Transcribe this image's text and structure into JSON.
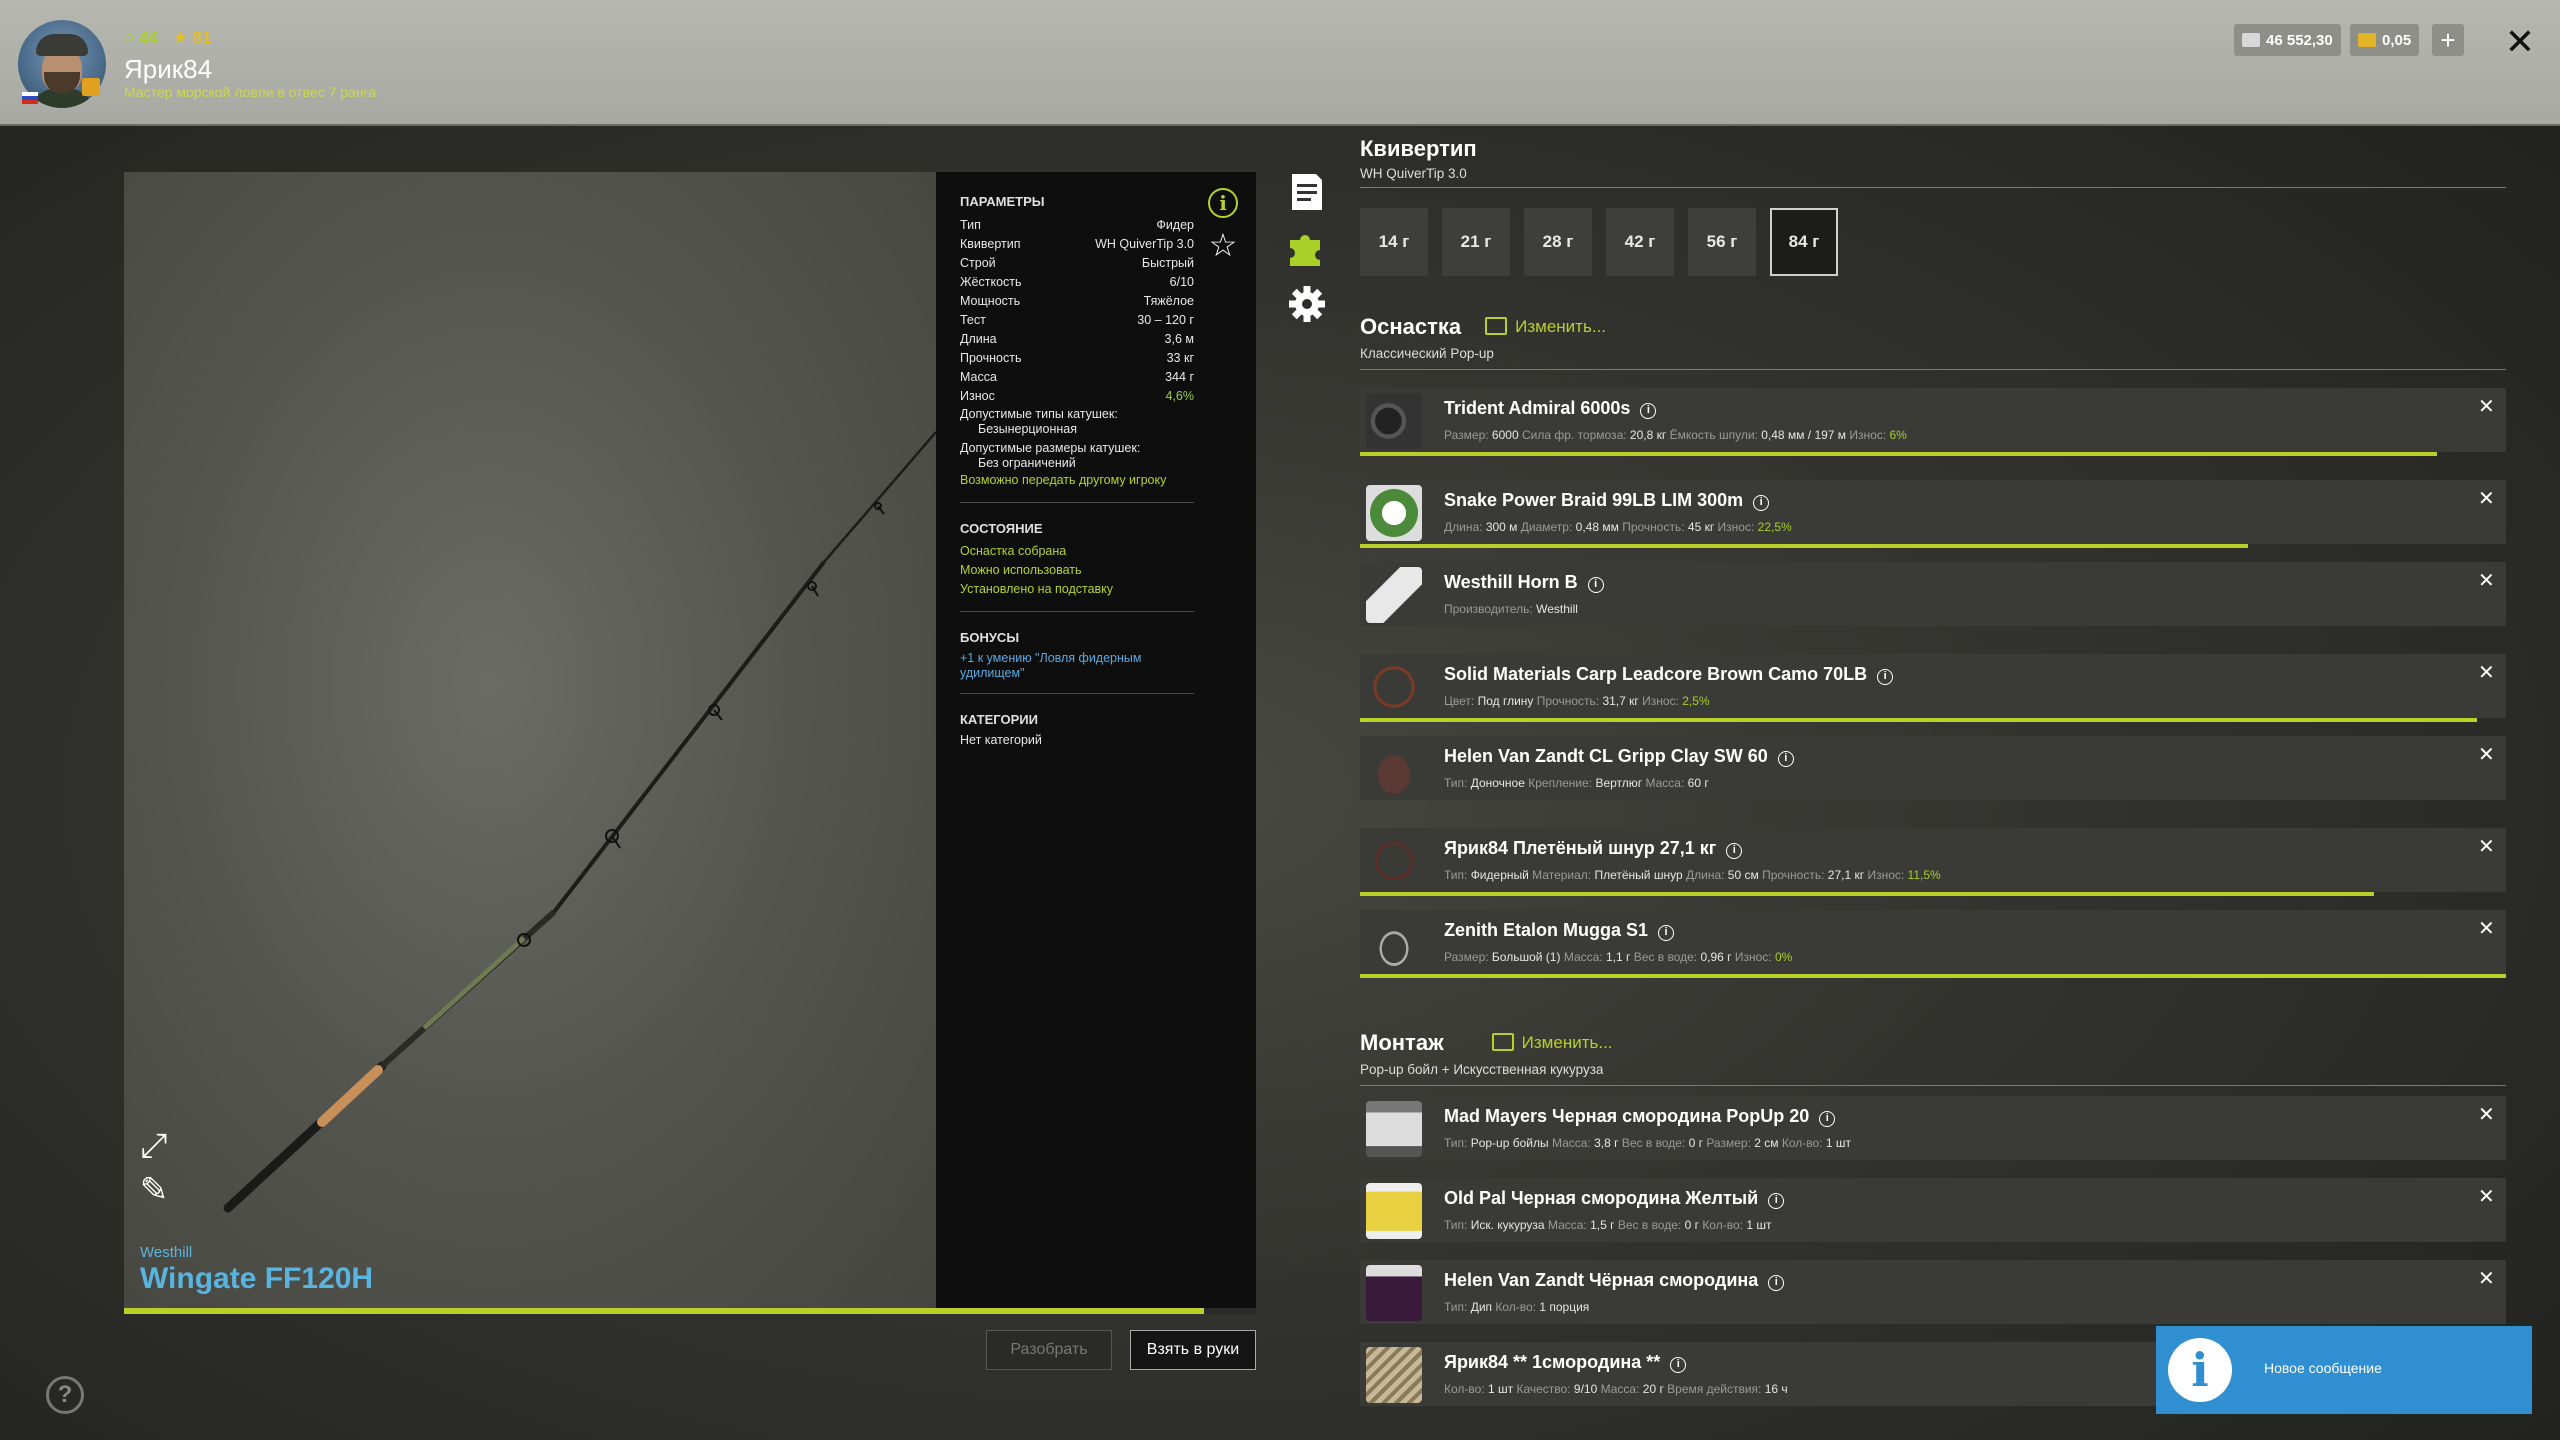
{
  "player": {
    "exp": "44",
    "rank": "81",
    "name": "Ярик84",
    "title": "Мастер морской ловли в отвес 7 ранга"
  },
  "currency": {
    "silver": "46 552,30",
    "gold": "0,05",
    "plus": "+"
  },
  "close": "✕",
  "rod": {
    "brand": "Westhill",
    "name": "Wingate FF120H",
    "wear_fraction": 0.954
  },
  "params": {
    "section_title": "ПАРАМЕТРЫ",
    "rows": [
      {
        "label": "Тип",
        "value": "Фидер"
      },
      {
        "label": "Квивертип",
        "value": "WH QuiverTip 3.0"
      },
      {
        "label": "Строй",
        "value": "Быстрый"
      },
      {
        "label": "Жёсткость",
        "value": "6/10"
      },
      {
        "label": "Мощность",
        "value": "Тяжёлое"
      },
      {
        "label": "Тест",
        "value": "30 – 120 г"
      },
      {
        "label": "Длина",
        "value": "3,6 м"
      },
      {
        "label": "Прочность",
        "value": "33 кг"
      },
      {
        "label": "Масса",
        "value": "344 г"
      },
      {
        "label": "Износ",
        "value": "4,6%"
      }
    ],
    "reel_types_label": "Допустимые типы катушек:",
    "reel_types_value": "Безынерционная",
    "reel_sizes_label": "Допустимые размеры катушек:",
    "reel_sizes_value": "Без ограничений",
    "transfer_note": "Возможно передать другому игроку",
    "state_title": "СОСТОЯНИЕ",
    "state_items": [
      "Оснастка собрана",
      "Можно использовать",
      "Установлено на подставку"
    ],
    "bonus_title": "БОНУСЫ",
    "bonus_text": "+1 к умению \"Ловля фидерным удилищем\"",
    "category_title": "КАТЕГОРИИ",
    "category_value": "Нет категорий"
  },
  "buttons": {
    "disassemble": "Разобрать",
    "take": "Взять в руки"
  },
  "quivertip": {
    "title": "Квивертип",
    "subtitle": "WH QuiverTip 3.0",
    "weights": [
      "14 г",
      "21 г",
      "28 г",
      "42 г",
      "56 г",
      "84 г"
    ],
    "active_index": 5
  },
  "tackle": {
    "title": "Оснастка",
    "change": "Изменить...",
    "subtitle": "Классический Pop-up",
    "items": [
      {
        "name": "Trident Admiral 6000s",
        "details": [
          [
            "Размер:",
            "6000"
          ],
          [
            "Сила фр. тормоза:",
            "20,8 кг"
          ],
          [
            "Ёмкость шпули:",
            "0,48 мм / 197 м"
          ],
          [
            "Износ:",
            "6%"
          ]
        ],
        "bar": 0.94
      },
      {
        "name": "Snake Power Braid 99LB LIM 300m",
        "details": [
          [
            "Длина:",
            "300 м"
          ],
          [
            "Диаметр:",
            "0,48 мм"
          ],
          [
            "Прочность:",
            "45 кг"
          ],
          [
            "Износ:",
            "22,5%"
          ]
        ],
        "bar": 0.775
      },
      {
        "name": "Westhill Horn B",
        "details": [
          [
            "Производитель:",
            "Westhill"
          ]
        ]
      },
      {
        "name": "Solid Materials Carp Leadcore Brown Camo 70LB",
        "details": [
          [
            "Цвет:",
            "Под глину"
          ],
          [
            "Прочность:",
            "31,7 кг"
          ],
          [
            "Износ:",
            "2,5%"
          ]
        ],
        "bar": 0.975
      },
      {
        "name": "Helen Van Zandt CL Gripp Clay SW 60",
        "details": [
          [
            "Тип:",
            "Доночное"
          ],
          [
            "Крепление:",
            "Вертлюг"
          ],
          [
            "Масса:",
            "60 г"
          ]
        ]
      },
      {
        "name": "Ярик84 Плетёный шнур 27,1 кг",
        "details": [
          [
            "Тип:",
            "Фидерный"
          ],
          [
            "Материал:",
            "Плетёный шнур"
          ],
          [
            "Длина:",
            "50 см"
          ],
          [
            "Прочность:",
            "27,1 кг"
          ],
          [
            "Износ:",
            "11,5%"
          ]
        ],
        "bar": 0.885
      },
      {
        "name": "Zenith Etalon Mugga S1",
        "details": [
          [
            "Размер:",
            "Большой (1)"
          ],
          [
            "Масса:",
            "1,1 г"
          ],
          [
            "Вес в воде:",
            "0,96 г"
          ],
          [
            "Износ:",
            "0%"
          ]
        ],
        "bar": 1.0
      }
    ]
  },
  "montage": {
    "title": "Монтаж",
    "change": "Изменить...",
    "subtitle": "Pop-up бойл + Искусственная кукуруза",
    "items": [
      {
        "name": "Mad Mayers Черная смородина PopUp 20",
        "details": [
          [
            "Тип:",
            "Pop-up бойлы"
          ],
          [
            "Масса:",
            "3,8 г"
          ],
          [
            "Вес в воде:",
            "0 г"
          ],
          [
            "Размер:",
            "2 см"
          ],
          [
            "Кол-во:",
            "1 шт"
          ]
        ]
      },
      {
        "name": "Old Pal Черная смородина Желтый",
        "details": [
          [
            "Тип:",
            "Иск. кукуруза"
          ],
          [
            "Масса:",
            "1,5 г"
          ],
          [
            "Вес в воде:",
            "0 г"
          ],
          [
            "Кол-во:",
            "1 шт"
          ]
        ]
      },
      {
        "name": "Helen Van Zandt Чёрная смородина",
        "details": [
          [
            "Тип:",
            "Дип"
          ],
          [
            "Кол-во:",
            "1 порция"
          ]
        ]
      },
      {
        "name": "Ярик84 ** 1смородина **",
        "details": [
          [
            "Кол-во:",
            "1 шт"
          ],
          [
            "Качество:",
            "9/10"
          ],
          [
            "Масса:",
            "20 г"
          ],
          [
            "Время действия:",
            "16 ч"
          ]
        ]
      }
    ]
  },
  "notification": {
    "text": "Новое сообщение"
  },
  "help": "?",
  "colors": {
    "accent": "#b8d028",
    "link_blue": "#5ab4e0",
    "notify_blue": "#2f8fd0"
  }
}
